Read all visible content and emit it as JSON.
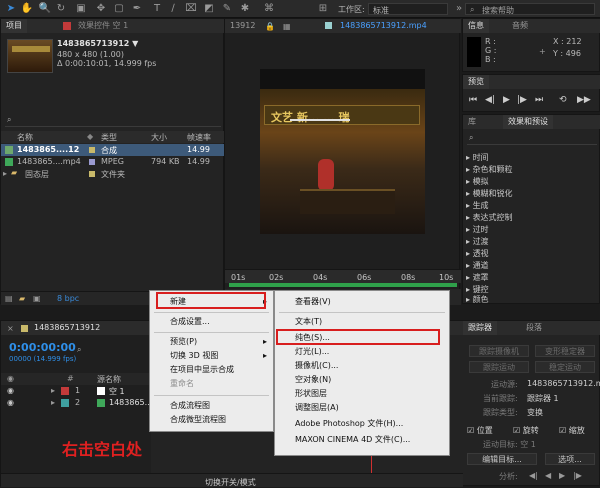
{
  "toolbar": {
    "workspace_label": "工作区:",
    "workspace_value": "标准",
    "search_placeholder": "搜索帮助"
  },
  "project_panel": {
    "tab_label": "项目",
    "effect_controls_tab": "效果控件 空 1",
    "comp_name": "1483865713912 ▼",
    "comp_size": "480 x 480 (1.00)",
    "comp_duration": "Δ 0:00:10:01, 14.999 fps",
    "columns": {
      "name": "名称",
      "type": "类型",
      "size": "大小",
      "rate": "帧速率"
    },
    "items": [
      {
        "name": "1483865....12",
        "type": "合成",
        "size": "",
        "rate": "14.99"
      },
      {
        "name": "1483865....mp4",
        "type": "MPEG",
        "size": "794 KB",
        "rate": "14.99"
      },
      {
        "name": "固态层",
        "type": "文件夹",
        "size": "",
        "rate": ""
      }
    ],
    "bpc": "8 bpc"
  },
  "composition_panel": {
    "tab_left": "13912",
    "tab_footage": "1483865713912.mp4",
    "video_text_overlay": "文艺 新...  ... 瑞",
    "ruler_labels": [
      "01s",
      "02s",
      "04s",
      "06s",
      "08s",
      "10s"
    ]
  },
  "info_panel": {
    "tab_info": "信息",
    "tab_audio": "音频",
    "r": "R :",
    "g": "G :",
    "b": "B :",
    "a": "A : 0",
    "x": "X : 212",
    "y": "Y : 496"
  },
  "preview_panel": {
    "tab": "预览"
  },
  "effects_panel": {
    "tab_library": "库",
    "tab_effects": "效果和预设",
    "categories": [
      "时间",
      "杂色和颗粒",
      "模拟",
      "模糊和锐化",
      "生成",
      "表达式控制",
      "过时",
      "过渡",
      "透视",
      "通道",
      "遮罩",
      "键控",
      "颜色"
    ]
  },
  "tracker_panel": {
    "tab_tracker": "跟踪器",
    "tab_paragraph": "段落",
    "track_camera": "跟踪摄像机",
    "warp_stabilizer": "变形稳定器",
    "track_motion": "跟踪运动",
    "stabilize_motion": "稳定运动",
    "motion_source_label": "运动源:",
    "motion_source_value": "1483865713912.m▼",
    "current_track_label": "当前跟踪:",
    "current_track_value": "跟踪器 1",
    "track_type_label": "跟踪类型:",
    "track_type_value": "变换",
    "position": "位置",
    "rotation": "旋转",
    "scale": "缩放",
    "motion_target": "运动目标: 空 1",
    "edit_target": "编辑目标...",
    "options": "选项...",
    "analyze": "分析:"
  },
  "timeline_panel": {
    "comp_tab": "1483865713912",
    "timecode": "0:00:00:00",
    "timecode_sub": "00000 (14.999 fps)",
    "col_source": "源名称",
    "layers": [
      {
        "num": "1",
        "name": "空 1",
        "color": "#c33a3a"
      },
      {
        "num": "2",
        "name": "1483865...",
        "color": "#3fa0a0"
      }
    ],
    "bottom_label": "切换开关/模式"
  },
  "context_menu": {
    "items": [
      "新建",
      "合成设置...",
      "预览(P)",
      "切换 3D 视图",
      "在项目中显示合成",
      "重命名",
      "合成流程图",
      "合成微型流程图"
    ]
  },
  "submenu": {
    "items": [
      "查看器(V)",
      "文本(T)",
      "纯色(S)...",
      "灯光(L)...",
      "摄像机(C)...",
      "空对象(N)",
      "形状图层",
      "调整图层(A)",
      "Adobe Photoshop 文件(H)...",
      "MAXON CINEMA 4D 文件(C)..."
    ]
  },
  "annotation": {
    "text": "右击空白处",
    "color": "#e02020"
  },
  "colors": {
    "accent_blue": "#3a8ad8",
    "timecode_blue": "#2f8fe8",
    "red_box": "#d81e1e"
  }
}
